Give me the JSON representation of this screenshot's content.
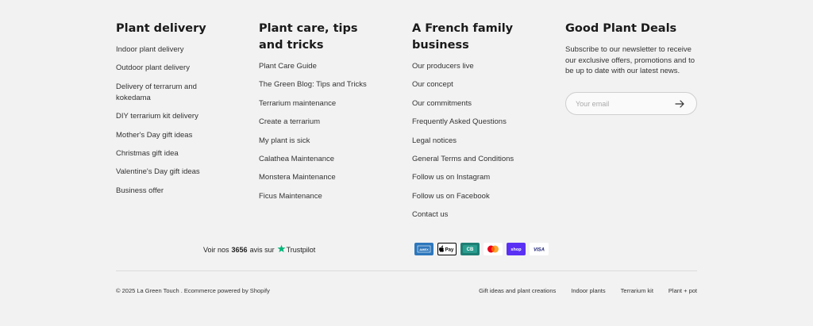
{
  "columns": [
    {
      "title": "Plant delivery",
      "links": [
        "Indoor plant delivery",
        "Outdoor plant delivery",
        "Delivery of terrarum and kokedama",
        "DIY terrarium kit delivery",
        "Mother's Day gift ideas",
        "Christmas gift idea",
        "Valentine's Day gift ideas",
        "Business offer"
      ]
    },
    {
      "title": "Plant care, tips and tricks",
      "links": [
        "Plant Care Guide",
        "The Green Blog: Tips and Tricks",
        "Terrarium maintenance",
        "Create a terrarium",
        "My plant is sick",
        "Calathea Maintenance",
        "Monstera Maintenance",
        "Ficus Maintenance"
      ]
    },
    {
      "title": "A French family business",
      "links": [
        "Our producers live",
        "Our concept",
        "Our commitments",
        "Frequently Asked Questions",
        "Legal notices",
        "General Terms and Conditions",
        "Follow us on Instagram",
        "Follow us on Facebook",
        "Contact us"
      ]
    }
  ],
  "newsletter": {
    "title": "Good Plant Deals",
    "description": "Subscribe to our newsletter to receive our exclusive offers, promotions and to be up to date with our latest news.",
    "placeholder": "Your email",
    "submit_icon": "arrow-right-icon"
  },
  "trustpilot": {
    "prefix": "Voir nos",
    "count": "3656",
    "middle": "avis sur",
    "brand": "Trustpilot",
    "star_color": "#00b67a"
  },
  "payments": [
    {
      "name": "American Express",
      "label": "AMEX",
      "bg": "#2e77bc",
      "fg": "#ffffff"
    },
    {
      "name": "Apple Pay",
      "label": "Pay",
      "bg": "#ffffff",
      "fg": "#000000"
    },
    {
      "name": "Cartes Bancaires",
      "label": "CB",
      "bg": "#1e7e74",
      "fg": "#ffffff"
    },
    {
      "name": "Mastercard",
      "label": "",
      "bg": "#ffffff",
      "fg": "#000000"
    },
    {
      "name": "Shop Pay",
      "label": "shop",
      "bg": "#5a31f4",
      "fg": "#ffffff"
    },
    {
      "name": "Visa",
      "label": "VISA",
      "bg": "#ffffff",
      "fg": "#1a1f71"
    }
  ],
  "footer": {
    "copyright": "© 2025 La Green Touch . Ecommerce powered by Shopify",
    "links": [
      "Gift ideas and plant creations",
      "Indoor plants",
      "Terrarium kit",
      "Plant + pot"
    ]
  }
}
